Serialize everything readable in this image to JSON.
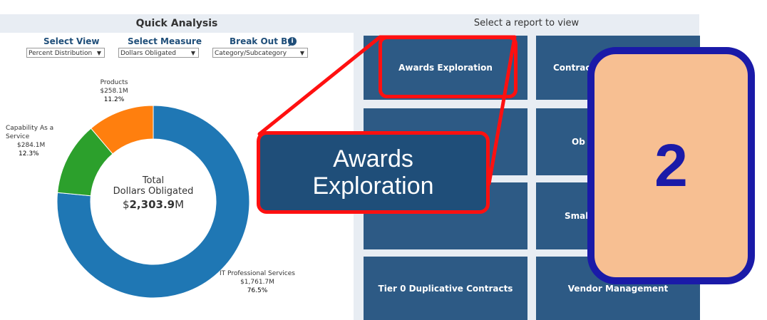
{
  "quick_analysis": {
    "title": "Quick Analysis",
    "filters": [
      {
        "label": "Select View",
        "value": "Percent Distribution"
      },
      {
        "label": "Select Measure",
        "value": "Dollars Obligated"
      },
      {
        "label": "Break Out By",
        "value": "Category/Subcategory"
      }
    ],
    "donut": {
      "center_line1": "Total",
      "center_line2": "Dollars Obligated",
      "center_prefix": "$",
      "center_value": "2,303.9",
      "center_suffix": "M",
      "segments": [
        {
          "name": "IT Professional Services",
          "amount": "$1,761.7M",
          "pct": "76.5%",
          "value": 76.5,
          "color": "#1f77b4"
        },
        {
          "name": "Capability As a Service",
          "amount": "$284.1M",
          "pct": "12.3%",
          "value": 12.3,
          "color": "#2ca02c"
        },
        {
          "name": "Products",
          "amount": "$258.1M",
          "pct": "11.2%",
          "value": 11.2,
          "color": "#ff7f0e"
        }
      ]
    }
  },
  "reports": {
    "title": "Select a report to view",
    "tiles": [
      "Awards Exploration",
      "Contrac",
      "",
      "Ob",
      "",
      "Smal",
      "Tier 0 Duplicative Contracts",
      "Vendor Management"
    ]
  },
  "callout": {
    "line1": "Awards",
    "line2": "Exploration"
  },
  "step_badge": "2",
  "colors": {
    "tile": "#2d5a85",
    "highlight": "#ff1010",
    "badge_fill": "#f7bf92",
    "badge_border": "#1a1aa8"
  }
}
